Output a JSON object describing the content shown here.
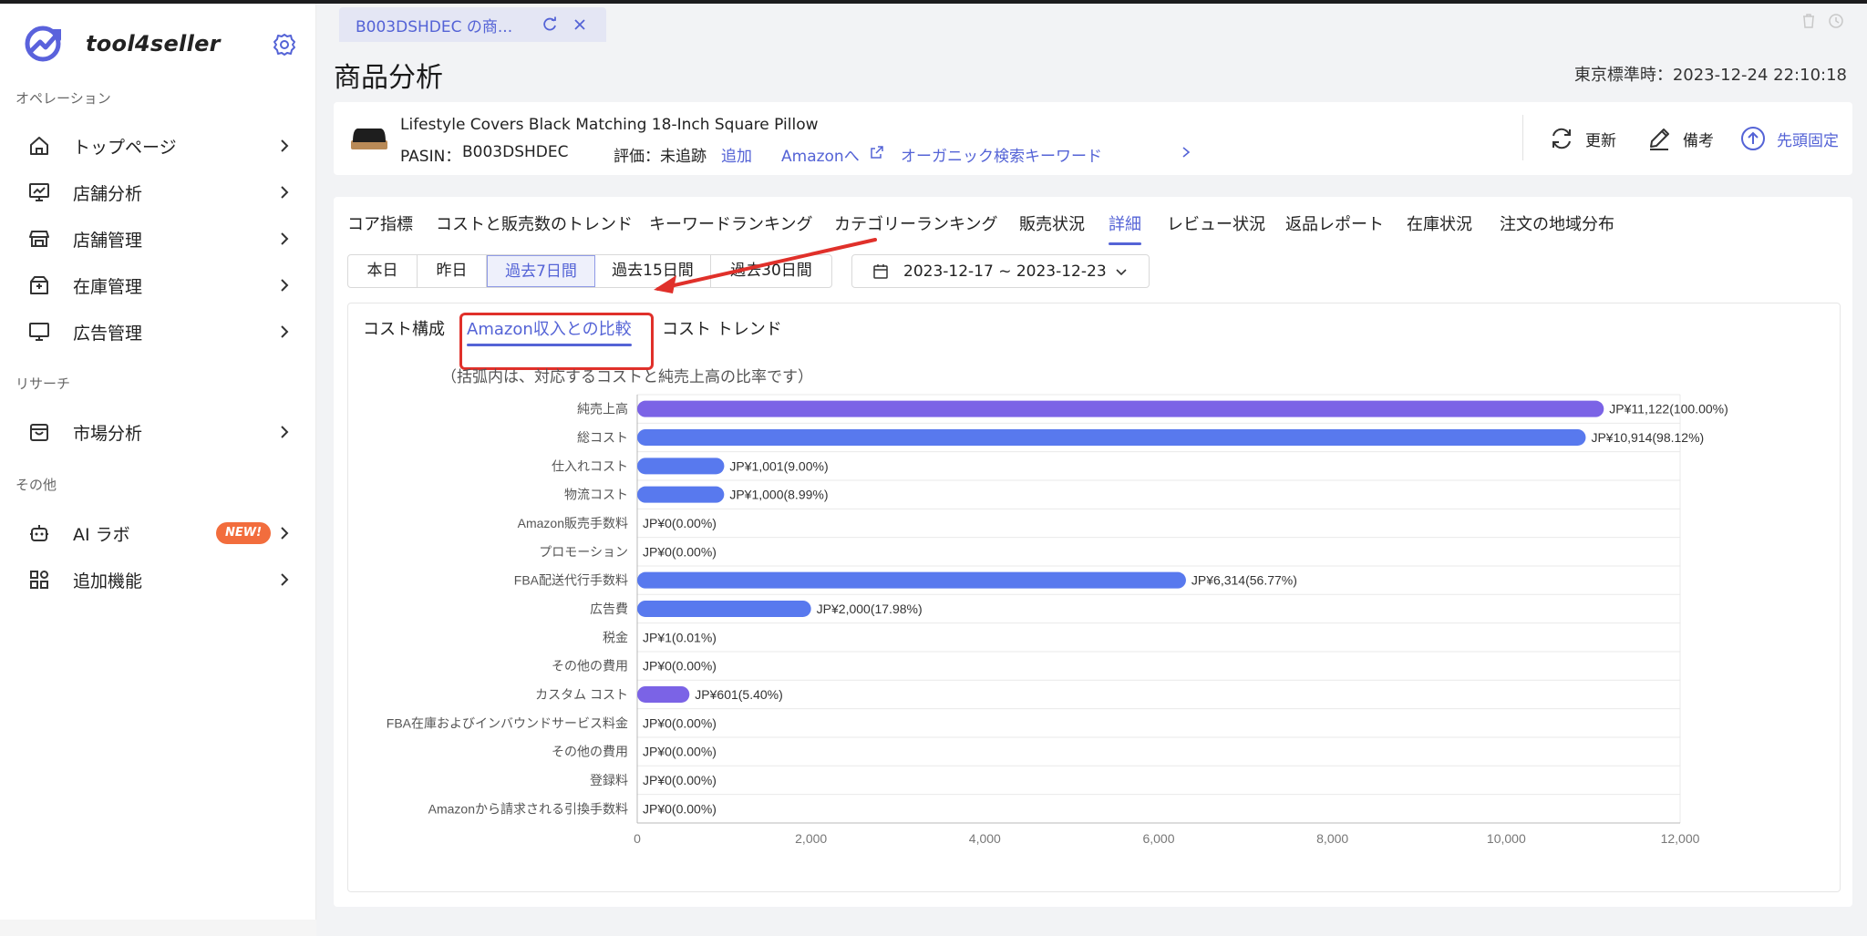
{
  "app": {
    "brand": "tool4seller",
    "page_title": "商品分析",
    "timezone_label": "東京標準時：",
    "timezone_value": "2023-12-24 22:10:18"
  },
  "colors": {
    "accent": "#5463d6",
    "bar_purple": "#7b63e6",
    "bar_blue": "#5879ee",
    "highlight": "#e0302a",
    "new_badge": "#f26d3d"
  },
  "sidebar": {
    "sections": [
      {
        "label": "オペレーション",
        "items": [
          {
            "label": "トップページ",
            "icon": "home-icon"
          },
          {
            "label": "店舗分析",
            "icon": "analytics-icon"
          },
          {
            "label": "店舗管理",
            "icon": "store-icon"
          },
          {
            "label": "在庫管理",
            "icon": "inventory-box-icon"
          },
          {
            "label": "広告管理",
            "icon": "monitor-icon"
          }
        ]
      },
      {
        "label": "リサーチ",
        "items": [
          {
            "label": "市場分析",
            "icon": "shopping-bag-icon"
          }
        ]
      },
      {
        "label": "その他",
        "items": [
          {
            "label": "AI ラボ",
            "icon": "robot-icon",
            "badge": "NEW!"
          },
          {
            "label": "追加機能",
            "icon": "apps-grid-icon"
          }
        ]
      }
    ]
  },
  "tab": {
    "label": "B003DSHDEC の商..."
  },
  "product": {
    "name": "Lifestyle Covers Black Matching 18-Inch Square Pillow",
    "pasin_label": "PASIN：",
    "pasin": "B003DSHDEC",
    "rating_label": "評価：未追跡",
    "add_link": "追加",
    "amazon_link": "Amazonへ",
    "organic_link": "オーガニック検索キーワード",
    "actions": {
      "refresh": "更新",
      "memo": "備考",
      "pin": "先頭固定"
    }
  },
  "nav_tabs": [
    "コア指標",
    "コストと販売数のトレンド",
    "キーワードランキング",
    "カテゴリーランキング",
    "販売状況",
    "詳細",
    "レビュー状況",
    "返品レポート",
    "在庫状況",
    "注文の地域分布"
  ],
  "nav_active": "詳細",
  "periods": [
    "本日",
    "昨日",
    "過去7日間",
    "過去15日間",
    "過去30日間"
  ],
  "period_active": "過去7日間",
  "date_range": "2023-12-17 ~ 2023-12-23",
  "sub_tabs": [
    "コスト構成",
    "Amazon収入との比較",
    "コスト トレンド"
  ],
  "sub_active": "Amazon収入との比較",
  "note": "（括弧内は、対応するコストと純売上高の比率です）",
  "chart_data": {
    "type": "bar",
    "orientation": "horizontal",
    "categories": [
      "純売上高",
      "総コスト",
      "仕入れコスト",
      "物流コスト",
      "Amazon販売手数料",
      "プロモーション",
      "FBA配送代行手数料",
      "広告費",
      "税金",
      "その他の費用",
      "カスタム コスト",
      "FBA在庫およびインバウンドサービス料金",
      "その他の費用",
      "登録料",
      "Amazonから請求される引換手数料"
    ],
    "values": [
      11122,
      10914,
      1001,
      1000,
      0,
      0,
      6314,
      2000,
      1,
      0,
      601,
      0,
      0,
      0,
      0
    ],
    "labels": [
      "JP¥11,122(100.00%)",
      "JP¥10,914(98.12%)",
      "JP¥1,001(9.00%)",
      "JP¥1,000(8.99%)",
      "JP¥0(0.00%)",
      "JP¥0(0.00%)",
      "JP¥6,314(56.77%)",
      "JP¥2,000(17.98%)",
      "JP¥1(0.01%)",
      "JP¥0(0.00%)",
      "JP¥601(5.40%)",
      "JP¥0(0.00%)",
      "JP¥0(0.00%)",
      "JP¥0(0.00%)",
      "JP¥0(0.00%)"
    ],
    "bar_colors": [
      "#7b63e6",
      "#5879ee",
      "#5879ee",
      "#5879ee",
      "#5879ee",
      "#5879ee",
      "#5879ee",
      "#5879ee",
      "#5879ee",
      "#5879ee",
      "#7b63e6",
      "#5879ee",
      "#5879ee",
      "#5879ee",
      "#5879ee"
    ],
    "xlim": [
      0,
      12000
    ],
    "xticks": [
      0,
      2000,
      4000,
      6000,
      8000,
      10000,
      12000
    ],
    "xtick_labels": [
      "0",
      "2,000",
      "4,000",
      "6,000",
      "8,000",
      "10,000",
      "12,000"
    ],
    "grid": "horizontal row lines"
  }
}
